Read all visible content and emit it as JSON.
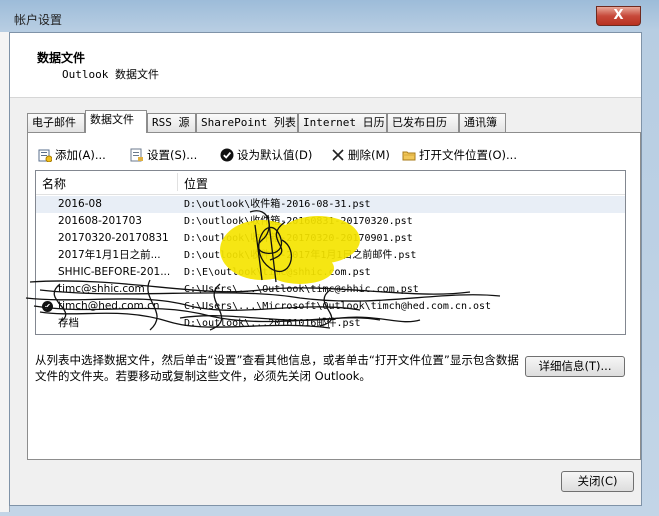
{
  "window": {
    "title": "帐户设置",
    "close_glyph": "X"
  },
  "header": {
    "title": "数据文件",
    "subtitle": "Outlook 数据文件"
  },
  "tabs": [
    {
      "label": "电子邮件",
      "active": false
    },
    {
      "label": "数据文件",
      "active": true
    },
    {
      "label": "RSS 源",
      "active": false
    },
    {
      "label": "SharePoint 列表",
      "active": false
    },
    {
      "label": "Internet 日历",
      "active": false
    },
    {
      "label": "已发布日历",
      "active": false
    },
    {
      "label": "通讯簿",
      "active": false
    }
  ],
  "toolbar": {
    "add_label": "添加(A)...",
    "settings_label": "设置(S)...",
    "default_label": "设为默认值(D)",
    "remove_label": "删除(M)",
    "open_location_label": "打开文件位置(O)..."
  },
  "list": {
    "columns": [
      "名称",
      "位置"
    ],
    "rows": [
      {
        "name": "2016-08",
        "location": "D:\\outlook\\收件箱-2016-08-31.pst",
        "selected": true,
        "default": false
      },
      {
        "name": "201608-201703",
        "location": "D:\\outlook\\收件箱-20160831-20170320.pst",
        "selected": false,
        "default": false
      },
      {
        "name": "20170320-20170831",
        "location": "D:\\outlook\\收件箱-20170320-20170901.pst",
        "selected": false,
        "default": false
      },
      {
        "name": "2017年1月1日之前...",
        "location": "D:\\outlook\\收件箱-2017年1月1日之前邮件.pst",
        "selected": false,
        "default": false
      },
      {
        "name": "SHHIC-BEFORE-201...",
        "location": "D:\\E\\outlook\\timc@shhic.com.pst",
        "selected": false,
        "default": false
      },
      {
        "name": "timc@shhic.com",
        "location": "C:\\Users\\...\\Outlook\\timc@shhic.com.pst",
        "selected": false,
        "default": false
      },
      {
        "name": "timch@hed.com.cn",
        "location": "C:\\Users\\...\\Microsoft\\Outlook\\timch@hed.com.cn.ost",
        "selected": false,
        "default": true
      },
      {
        "name": "存档",
        "location": "D:\\outlook\\...20161016邮件.pst",
        "selected": false,
        "default": false
      }
    ]
  },
  "description": "从列表中选择数据文件，然后单击“设置”查看其他信息，或者单击“打开文件位置”显示包含数据文件的文件夹。若要移动或复制这些文件，必须先关闭 Outlook。",
  "buttons": {
    "details_label": "详细信息(T)...",
    "close_label": "关闭(C)"
  },
  "colors": {
    "scribble_yellow": "#f5e400",
    "scribble_ink": "#111111"
  }
}
